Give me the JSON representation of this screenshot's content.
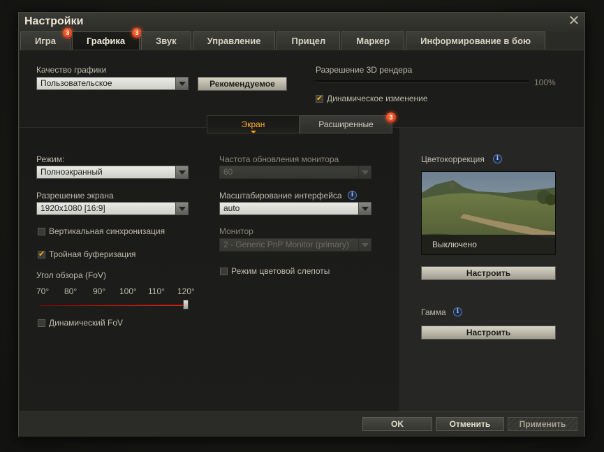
{
  "window": {
    "title": "Настройки"
  },
  "tabs": [
    {
      "label": "Игра",
      "badge": "3"
    },
    {
      "label": "Графика",
      "badge": "3",
      "active": true
    },
    {
      "label": "Звук"
    },
    {
      "label": "Управление"
    },
    {
      "label": "Прицел"
    },
    {
      "label": "Маркер"
    },
    {
      "label": "Информирование в бою"
    }
  ],
  "top": {
    "quality_label": "Качество графики",
    "quality_value": "Пользовательское",
    "recommended_button": "Рекомендуемое",
    "render_res_label": "Разрешение 3D рендера",
    "render_res_value": "100%",
    "render_res_fraction": 1.0,
    "dynamic_change_label": "Динамическое изменение",
    "dynamic_change_checked": true
  },
  "subtabs": [
    {
      "label": "Экран",
      "active": true
    },
    {
      "label": "Расширенные",
      "badge": "3"
    }
  ],
  "left": {
    "mode_label": "Режим:",
    "mode_value": "Полноэкранный",
    "resolution_label": "Разрешение экрана",
    "resolution_value": "1920x1080 [16:9]",
    "vsync_label": "Вертикальная синхронизация",
    "vsync_checked": false,
    "triple_buffer_label": "Тройная буферизация",
    "triple_buffer_checked": true,
    "fov_label": "Угол обзора (FoV)",
    "fov_ticks": [
      "70°",
      "80°",
      "90°",
      "100°",
      "110°",
      "120°"
    ],
    "fov_value": 120,
    "dynamic_fov_label": "Динамический FoV",
    "dynamic_fov_checked": false
  },
  "middle": {
    "refresh_label": "Частота обновления монитора",
    "refresh_value": "60",
    "scale_label": "Масштабирование интерфейса",
    "scale_value": "auto",
    "monitor_label": "Монитор",
    "monitor_value": "2 - Generic PnP Monitor (primary)",
    "colorblind_label": "Режим цветовой слепоты",
    "colorblind_checked": false
  },
  "right": {
    "color_correction_label": "Цветокоррекция",
    "preview_caption": "Выключено",
    "color_setup_button": "Настроить",
    "gamma_label": "Гамма",
    "gamma_setup_button": "Настроить"
  },
  "footer": {
    "ok": "OK",
    "cancel": "Отменить",
    "apply": "Применить"
  },
  "icons": {
    "close": "close-icon",
    "info": "info-icon",
    "check": "checkmark-icon",
    "dropdown": "chevron-down-icon"
  },
  "colors": {
    "accent": "#ff9b22",
    "badge": "#e03a14",
    "check": "#ffb000",
    "slider": "#c42b1c"
  }
}
